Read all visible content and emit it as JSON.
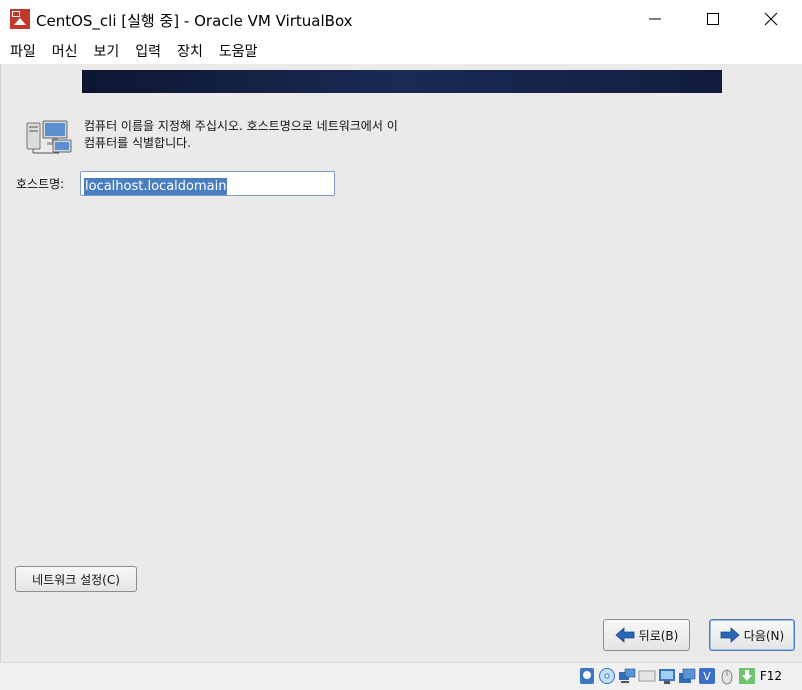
{
  "window": {
    "title": "CentOS_cli [실행 중] - Oracle VM VirtualBox"
  },
  "menu": {
    "items": [
      "파일",
      "머신",
      "보기",
      "입력",
      "장치",
      "도움말"
    ]
  },
  "installer": {
    "description": "컴퓨터 이름을 지정해 주십시오. 호스트명으로 네트워크에서 이 컴퓨터를 식별합니다.",
    "hostname_label": "호스트명:",
    "hostname_value": "localhost.localdomain",
    "network_button": "네트워크 설정(C)",
    "back_button": "뒤로(B)",
    "next_button": "다음(N)"
  },
  "statusbar": {
    "host_key": "F12"
  },
  "colors": {
    "banner": "#1a2a55",
    "vm_background": "#ebeae8",
    "selection": "#4a7ec0",
    "arrow": "#2a66b8"
  }
}
